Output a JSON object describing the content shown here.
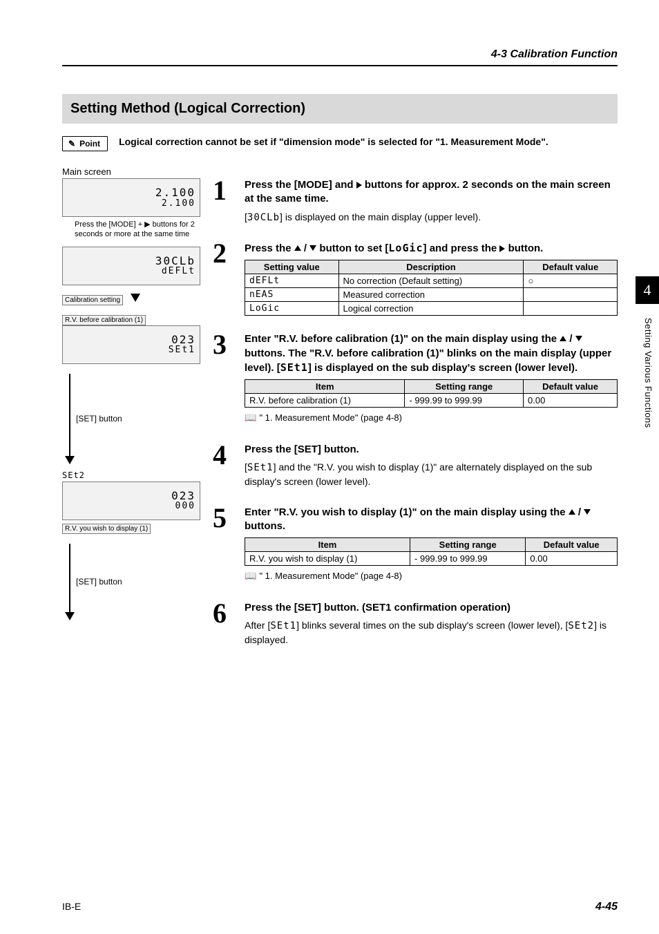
{
  "header": {
    "section": "4-3  Calibration Function"
  },
  "title": "Setting Method (Logical Correction)",
  "point": {
    "badge": "Point",
    "text": "Logical correction cannot be set if \"dimension mode\" is selected for \"1. Measurement Mode\"."
  },
  "left": {
    "main_screen_label": "Main screen",
    "screen1_line1": "2.100",
    "screen1_line2": "2.100",
    "hold_note": "Press the [MODE] + ▶ buttons for 2 seconds or more at the same time",
    "screen2_line1": "30CLb",
    "screen2_line2": "dEFLt",
    "calib_setting": "Calibration setting",
    "rv_before_caption": "R.V. before calibration (1)",
    "screen3_line1": "023",
    "screen3_line2": "SEt1",
    "set_button_label": "[SET] button",
    "set2_label": "SEt2",
    "screen4_line1": "023",
    "screen4_line2": "000",
    "rv_display_caption": "R.V. you wish to display (1)"
  },
  "steps": {
    "s1": {
      "head_a": "Press the [MODE] and ",
      "head_b": " buttons for approx. 2 seconds on the main screen at the same time.",
      "body_a": "[",
      "body_seg": "30CLb",
      "body_b": "] is displayed on the main display (upper level)."
    },
    "s2": {
      "head_a": "Press the ",
      "head_b": " button to set [",
      "head_seg": "LoGic",
      "head_c": "] and press the ",
      "head_d": " button.",
      "table": {
        "h1": "Setting value",
        "h2": "Description",
        "h3": "Default value",
        "r1c1": "dEFLt",
        "r1c2": "No correction (Default setting)",
        "r1c3": "○",
        "r2c1": "nEAS",
        "r2c2": "Measured correction",
        "r2c3": "",
        "r3c1": "LoGic",
        "r3c2": "Logical correction",
        "r3c3": ""
      }
    },
    "s3": {
      "head_a": "Enter \"R.V. before calibration (1)\" on the main display using the ",
      "head_b": " buttons. The \"R.V. before calibration (1)\" blinks on the main display (upper level). [",
      "head_seg": "SEt1",
      "head_c": "] is displayed on the sub display's screen (lower level).",
      "table": {
        "h1": "Item",
        "h2": "Setting range",
        "h3": "Default value",
        "r1c1": "R.V. before calibration (1)",
        "r1c2": "- 999.99 to 999.99",
        "r1c3": "0.00"
      },
      "ref": "\" 1. Measurement Mode\" (page 4-8)"
    },
    "s4": {
      "head": "Press the [SET] button.",
      "body_a": "[",
      "body_seg": "SEt1",
      "body_b": "] and the \"R.V. you wish to display (1)\" are alternately displayed on the sub display's screen (lower level)."
    },
    "s5": {
      "head_a": "Enter \"R.V. you wish to display (1)\" on the main display using the ",
      "head_b": " buttons.",
      "table": {
        "h1": "Item",
        "h2": "Setting range",
        "h3": "Default value",
        "r1c1": "R.V. you wish to display (1)",
        "r1c2": "- 999.99 to 999.99",
        "r1c3": "0.00"
      },
      "ref": "\" 1. Measurement Mode\" (page 4-8)"
    },
    "s6": {
      "head": "Press the [SET] button. (SET1 confirmation operation)",
      "body_a": "After [",
      "body_seg1": "SEt1",
      "body_b": "] blinks several times on the sub display's screen (lower level), [",
      "body_seg2": "SEt2",
      "body_c": "] is displayed."
    }
  },
  "side": {
    "chapter": "4",
    "label": "Setting Various Functions"
  },
  "footer": {
    "doc": "IB-E",
    "page": "4-45"
  }
}
